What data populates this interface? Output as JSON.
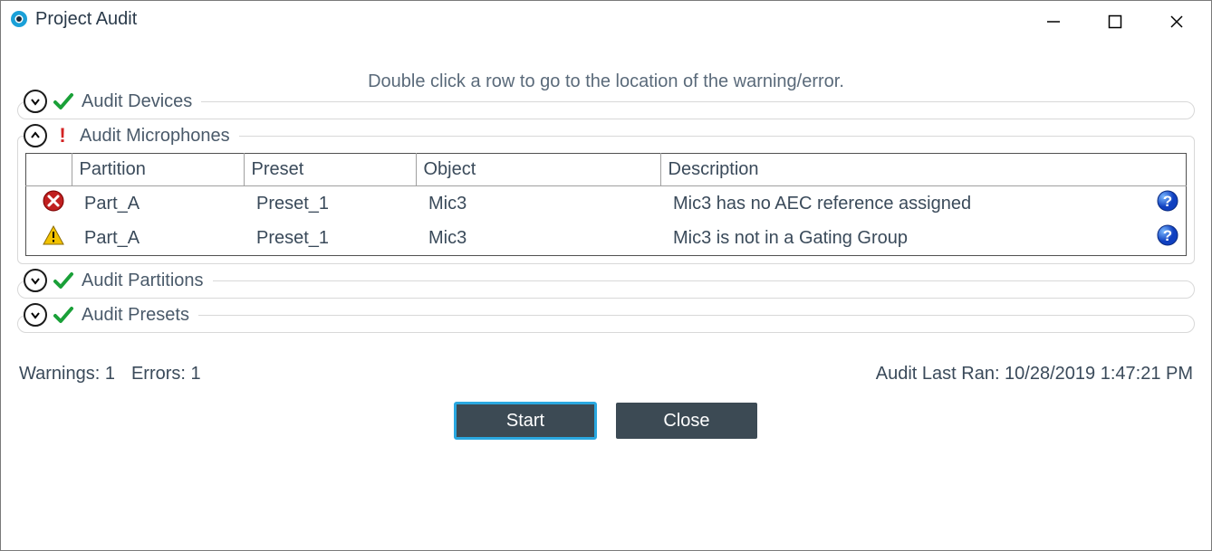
{
  "window": {
    "title": "Project Audit"
  },
  "instruction": "Double click a row to go to the location of the warning/error.",
  "sections": {
    "devices": {
      "title": "Audit Devices"
    },
    "microphones": {
      "title": "Audit Microphones",
      "columns": {
        "partition": "Partition",
        "preset": "Preset",
        "object": "Object",
        "description": "Description"
      },
      "rows": [
        {
          "severity": "error",
          "partition": "Part_A",
          "preset": "Preset_1",
          "object": "Mic3",
          "description": "Mic3 has no AEC reference assigned"
        },
        {
          "severity": "warning",
          "partition": "Part_A",
          "preset": "Preset_1",
          "object": "Mic3",
          "description": "Mic3 is not in a Gating Group"
        }
      ]
    },
    "partitions": {
      "title": "Audit Partitions"
    },
    "presets": {
      "title": "Audit Presets"
    }
  },
  "footer": {
    "warnings_label": "Warnings: 1",
    "errors_label": "Errors: 1",
    "last_ran_label": "Audit Last Ran: 10/28/2019 1:47:21 PM"
  },
  "buttons": {
    "start": "Start",
    "close": "Close"
  }
}
